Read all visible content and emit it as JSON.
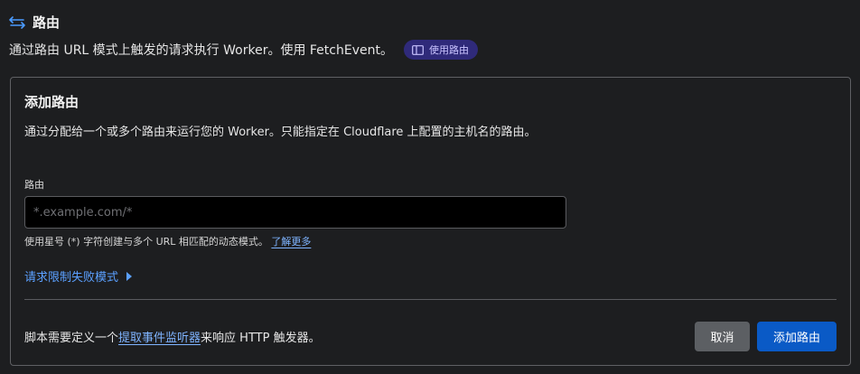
{
  "header": {
    "title": "路由",
    "icon": "route-arrows-icon"
  },
  "description": {
    "text": "通过路由 URL 模式上触发的请求执行 Worker。使用 FetchEvent。",
    "docs_badge_label": "使用路由",
    "docs_badge_icon": "book-icon"
  },
  "card": {
    "title": "添加路由",
    "description": "通过分配给一个或多个路由来运行您的 Worker。只能指定在 Cloudflare 上配置的主机名的路由。",
    "field_label": "路由",
    "input": {
      "value": "",
      "placeholder": "*.example.com/*"
    },
    "helper_text": "使用星号 (*) 字符创建与多个 URL 相匹配的动态模式。",
    "helper_link": "了解更多",
    "failure_mode_toggle": "请求限制失败模式",
    "footer": {
      "text_before": "脚本需要定义一个",
      "link": "提取事件监听器",
      "text_after": "来响应 HTTP 触发器。"
    },
    "buttons": {
      "cancel": "取消",
      "add": "添加路由"
    }
  },
  "colors": {
    "background": "#1d1e20",
    "accent_link": "#7fb4ff",
    "primary_button": "#0a5ac6",
    "secondary_button": "#5c5f63",
    "badge_bg": "#2f2a7a",
    "badge_text": "#c9c3ff"
  }
}
